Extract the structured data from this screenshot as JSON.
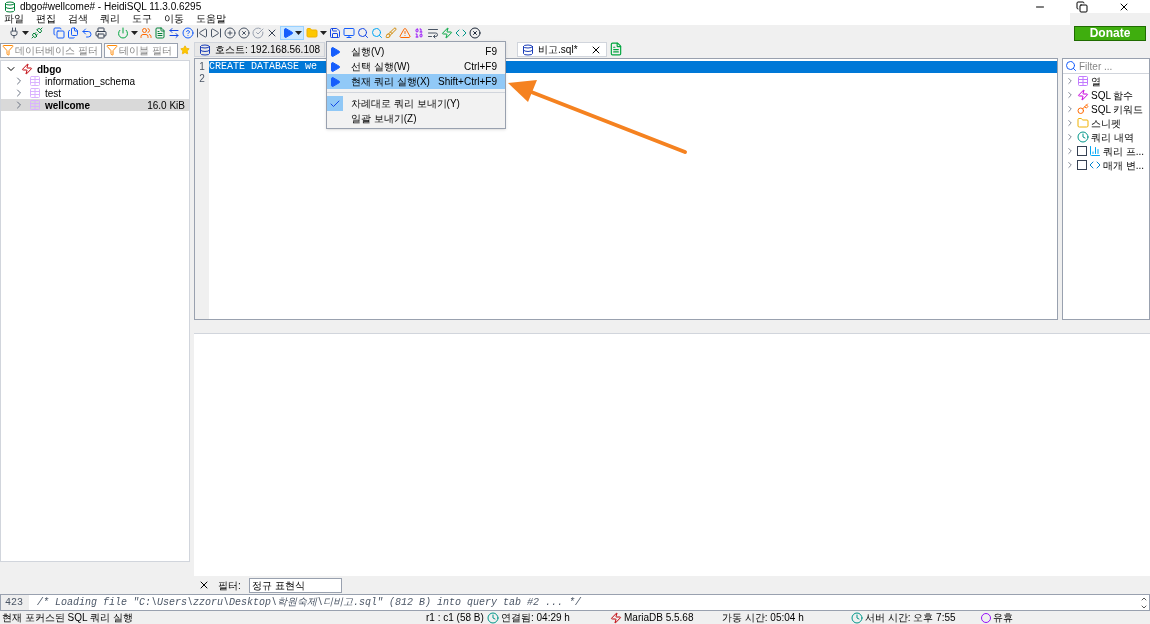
{
  "window": {
    "title": "dbgo#wellcome# - HeidiSQL 11.3.0.6295"
  },
  "menu": [
    "파일",
    "편집",
    "검색",
    "쿼리",
    "도구",
    "이동",
    "도움말"
  ],
  "donate": "Donate",
  "filters": {
    "database": {
      "placeholder": "데이터베이스 필터"
    },
    "table": {
      "placeholder": "테이블 필터"
    }
  },
  "tree": [
    {
      "name": "dbgo",
      "expanded": true,
      "children": [
        {
          "name": "information_schema",
          "selected": false
        },
        {
          "name": "test",
          "selected": false
        },
        {
          "name": "wellcome",
          "size": "16.0 KiB",
          "selected": true
        }
      ]
    }
  ],
  "tabs": [
    {
      "label": "호스트: 192.168.56.108",
      "selected": false
    },
    {
      "label": "비고.sql*",
      "selected": true
    }
  ],
  "editor": {
    "lines": [
      {
        "number": "1",
        "text": "CREATE DATABASE we",
        "selected": true
      },
      {
        "number": "2",
        "selected": false
      }
    ]
  },
  "dropdown": [
    {
      "kind": "item",
      "label": "실행(V)",
      "shortcut": "F9",
      "checked": false,
      "selected": false
    },
    {
      "kind": "item",
      "label": "선택 실행(W)",
      "shortcut": "Ctrl+F9",
      "checked": false,
      "selected": false
    },
    {
      "kind": "item",
      "label": "현재 쿼리 실행(X)",
      "shortcut": "Shift+Ctrl+F9",
      "checked": false,
      "selected": true
    },
    {
      "kind": "separator"
    },
    {
      "kind": "item",
      "label": "차례대로 쿼리 보내기(Y)",
      "checked": true,
      "selected": false
    },
    {
      "kind": "item",
      "label": "일괄 보내기(Z)",
      "checked": false,
      "selected": false
    }
  ],
  "helpers": {
    "placeholder": "Filter ...",
    "items": [
      {
        "kind": "plain",
        "label": "열"
      },
      {
        "kind": "plain",
        "label": "SQL 함수"
      },
      {
        "kind": "plain",
        "label": "SQL 키워드"
      },
      {
        "kind": "plain",
        "label": "스니펫"
      },
      {
        "kind": "plain",
        "label": "쿼리 내역"
      },
      {
        "kind": "check",
        "label": "쿼리 프...",
        "checked": false
      },
      {
        "kind": "check",
        "label": "매개 변...",
        "checked": false
      }
    ]
  },
  "result_filter": {
    "label": "필터:",
    "value": "정규 표현식"
  },
  "log": [
    {
      "number": "423",
      "text": "/* Loading file \"C:\\Users\\zzoru\\Desktop\\학원숙제\\디비고.sql\" (812 B) into query tab #2 ... */"
    }
  ],
  "status_bar": [
    "현재 포커스된 SQL 쿼리 실행",
    "r1 : c1 (58 B)",
    "연결됨: 04:29 h",
    "MariaDB 5.5.68",
    "가동 시간: 05:04 h",
    "서버 시간: 오후 7:55",
    "유휴"
  ]
}
